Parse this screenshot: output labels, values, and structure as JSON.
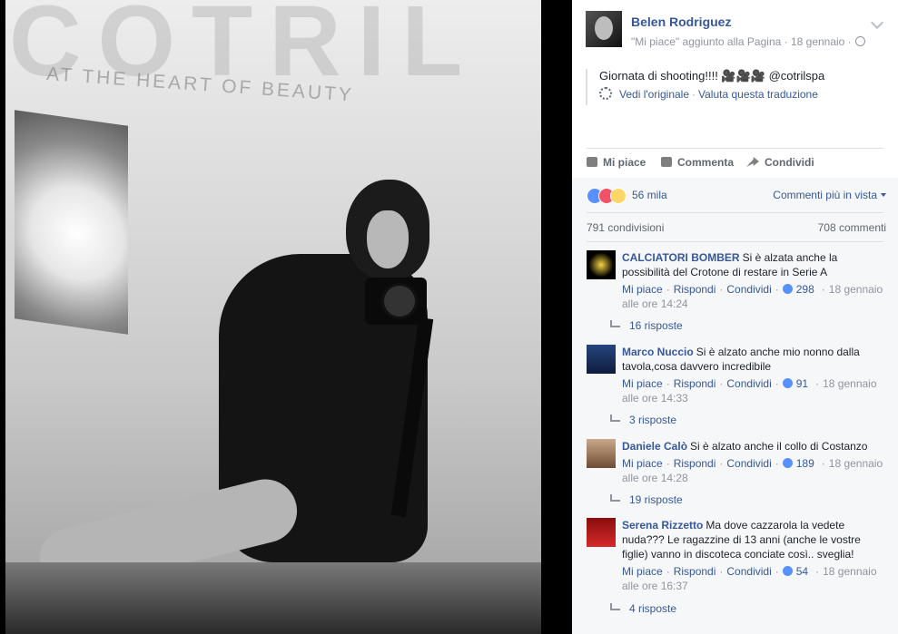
{
  "post": {
    "author": "Belen Rodriguez",
    "subtitle": "\"Mi piace\" aggiunto alla Pagina · 18 gennaio ·",
    "text": "Giornata di shooting!!!! 🎥🎥🎥 @cotrilspa",
    "see_original": "Vedi l'originale",
    "rate_translation": "Valuta questa traduzione",
    "photo_wall_text": "COTRIL",
    "photo_wall_tagline": "AT THE HEART OF BEAUTY"
  },
  "actions": {
    "like": "Mi piace",
    "comment": "Commenta",
    "share": "Condividi"
  },
  "reactions": {
    "count": "56 mila",
    "sort_label": "Commenti più in vista",
    "shares": "791 condivisioni",
    "comments": "708 commenti"
  },
  "comment_labels": {
    "like": "Mi piace",
    "reply": "Rispondi",
    "share": "Condividi"
  },
  "comments": [
    {
      "author": "CALCIATORI BOMBER",
      "text": "Si è alzata anche la possibilità del Crotone di restare in Serie A",
      "likes": "298",
      "date": "18 gennaio alle ore 14:24",
      "replies": "16 risposte"
    },
    {
      "author": "Marco Nuccio",
      "text": "Si è alzato anche mio nonno dalla tavola,cosa davvero incredibile",
      "likes": "91",
      "date": "18 gennaio alle ore 14:33",
      "replies": "3 risposte"
    },
    {
      "author": "Daniele Calò",
      "text": "Si è alzato anche il collo di Costanzo",
      "likes": "189",
      "date": "18 gennaio alle ore 14:28",
      "replies": "19 risposte"
    },
    {
      "author": "Serena Rizzetto",
      "text": "Ma dove cazzarola la vedete nuda??? Le ragazzine di 13 anni (anche le vostre figlie) vanno in discoteca conciate così.. sveglia!",
      "likes": "54",
      "date": "18 gennaio alle ore 16:37",
      "replies": "4 risposte"
    }
  ],
  "colors": {
    "link": "#365899",
    "meta": "#90949c",
    "like_blue": "#5890ff",
    "love_red": "#f25268",
    "wow_yellow": "#fcd667"
  }
}
